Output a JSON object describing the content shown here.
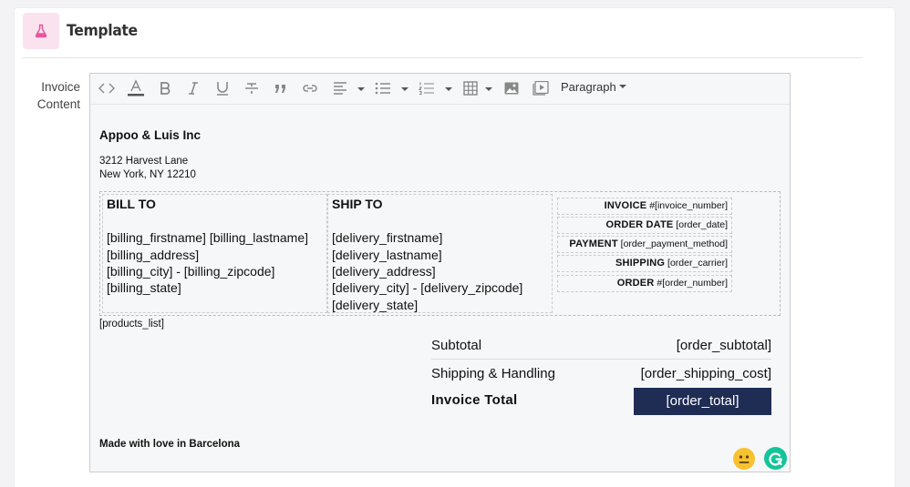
{
  "header": {
    "title": "Template",
    "icon": "flask-icon",
    "icon_color": "#e5579b"
  },
  "field": {
    "label": "Invoice Content"
  },
  "toolbar": {
    "buttons": [
      "code-icon",
      "text-color-icon",
      "bold-icon",
      "italic-icon",
      "underline-icon",
      "strikethrough-icon",
      "blockquote-icon",
      "link-icon",
      "align-icon",
      "bullet-list-icon",
      "numbered-list-icon",
      "table-icon",
      "image-icon",
      "media-icon"
    ],
    "format_select": "Paragraph"
  },
  "invoice": {
    "company": "Appoo & Luis Inc",
    "address_line1": "3212 Harvest Lane",
    "address_line2": "New York, NY 12210",
    "bill_to": {
      "heading": "BILL TO",
      "lines": [
        "[billing_firstname] [billing_lastname]",
        "[billing_address]",
        "[billing_city] - [billing_zipcode]",
        "[billing_state]"
      ]
    },
    "ship_to": {
      "heading": "SHIP TO",
      "lines": [
        "[delivery_firstname]",
        "[delivery_lastname]",
        "[delivery_address]",
        "[delivery_city] - [delivery_zipcode]",
        "[delivery_state]"
      ]
    },
    "meta": [
      {
        "label": "INVOICE",
        "value": "#[invoice_number]"
      },
      {
        "label": "ORDER DATE",
        "value": "[order_date]"
      },
      {
        "label": "PAYMENT",
        "value": "[order_payment_method]"
      },
      {
        "label": "SHIPPING",
        "value": "[order_carrier]"
      },
      {
        "label": "ORDER",
        "value": "#[order_number]"
      }
    ],
    "products": "[products_list]",
    "subtotal": {
      "label": "Subtotal",
      "value": "[order_subtotal]"
    },
    "shipping": {
      "label": "Shipping & Handling",
      "value": "[order_shipping_cost]"
    },
    "total": {
      "label": "Invoice Total",
      "value": "[order_total]"
    },
    "total_bg": "#1f2d55",
    "footer": "Made with love in Barcelona"
  },
  "widgets": {
    "emoji": "neutral-face-icon",
    "grammarly": "grammarly-icon"
  }
}
